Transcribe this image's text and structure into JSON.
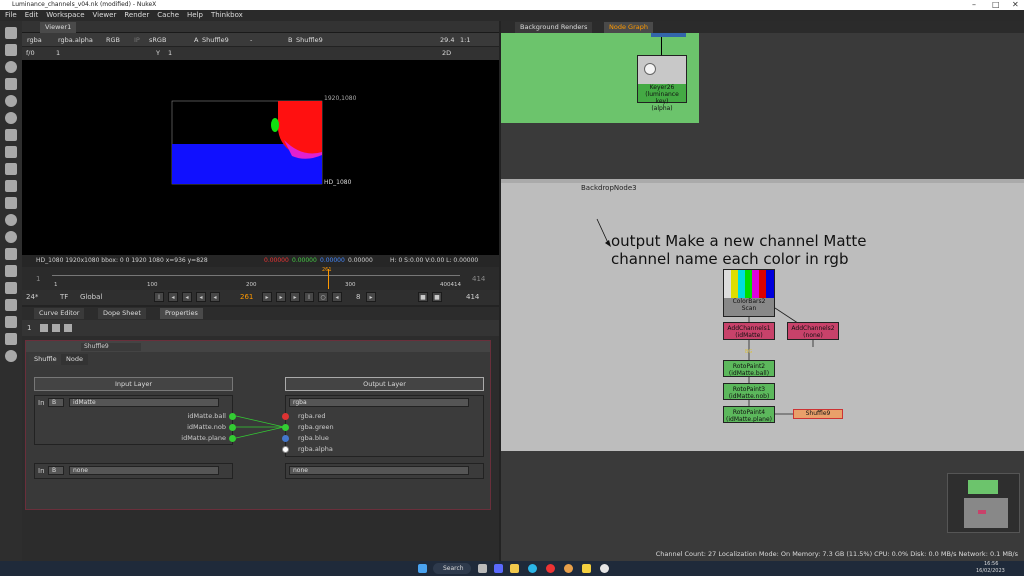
{
  "window": {
    "title": "Luminance_channels_v04.nk (modified) - NukeX"
  },
  "menu": [
    "File",
    "Edit",
    "Workspace",
    "Viewer",
    "Render",
    "Cache",
    "Help",
    "Thinkbox"
  ],
  "viewer": {
    "tab": "Viewer1",
    "channels": "rgba",
    "alpha": "rgba.alpha",
    "display": "RGB",
    "ip": "IP",
    "lut": "sRGB",
    "input_a": "A",
    "input_a_node": "Shuffle9",
    "dash": "-",
    "input_b": "B",
    "input_b_node": "Shuffle9",
    "gain": "29.4",
    "zoom": "1:1",
    "fstop": "f/0",
    "frame_x": "1",
    "y_label": "Y",
    "y_value": "1",
    "mode_2d": "2D",
    "format_top": "1920,1080",
    "format_bottom": "HD_1080",
    "info": {
      "left": "HD_1080 1920x1080  bbox: 0 0 1920 1080  x=936 y=828",
      "r": "0.00000",
      "g": "0.00000",
      "b": "0.00000",
      "a": "0.00000",
      "hsv": "H:  0 S:0.00 V:0.00  L: 0.00000"
    },
    "timeline": {
      "start": "1",
      "end": "414",
      "ticks": [
        "1",
        "100",
        "200",
        "300",
        "400414"
      ],
      "current_marker": "261",
      "fps": "24*",
      "tf": "TF",
      "scope": "Global",
      "current": "261",
      "step": "8",
      "end_display": "414"
    }
  },
  "props": {
    "tabs": [
      "Curve Editor",
      "Dope Sheet",
      "Properties"
    ],
    "count": "1",
    "node_name": "Shuffle9",
    "node_tabs": [
      "Shuffle",
      "Node"
    ],
    "input_layer": "Input Layer",
    "output_layer": "Output Layer",
    "in1": {
      "label": "In",
      "num": "B",
      "layer": "idMatte"
    },
    "in2": {
      "label": "In",
      "num": "B",
      "layer": "none"
    },
    "out1": "rgba",
    "out2": "none",
    "in_channels": [
      "idMatte.ball",
      "idMatte.nob",
      "idMatte.plane"
    ],
    "out_channels": [
      "rgba.red",
      "rgba.green",
      "rgba.blue",
      "rgba.alpha"
    ]
  },
  "nodegraph": {
    "tabs": [
      "Background Renders",
      "Node Graph"
    ],
    "keyer": "Keyer26 (luminance key)\n(alpha)",
    "backdrop": "BackdropNode3",
    "note": "output Make a new channel Matte\nchannel name  each color in rgb",
    "nodes": {
      "colorbars": "ColorBars2\nScan",
      "addch1": "AddChannels1\n(idMatte)",
      "addch2": "AddChannels2\n(none)",
      "roto2": "RotoPaint2\n(idMatte.ball)",
      "roto3": "RotoPaint3\n(idMatte.nob)",
      "roto4": "RotoPaint4\n(idMatte.plane)",
      "shuffle": "Shuffle9"
    },
    "edge_label": "BG"
  },
  "status": "Channel Count: 27  Localization Mode: On  Memory: 7.3 GB (11.5%)  CPU: 0.0%  Disk: 0.0 MB/s  Network: 0.1 MB/s",
  "taskbar": {
    "search": "Search",
    "time": "16:56",
    "date": "16/02/2023"
  }
}
